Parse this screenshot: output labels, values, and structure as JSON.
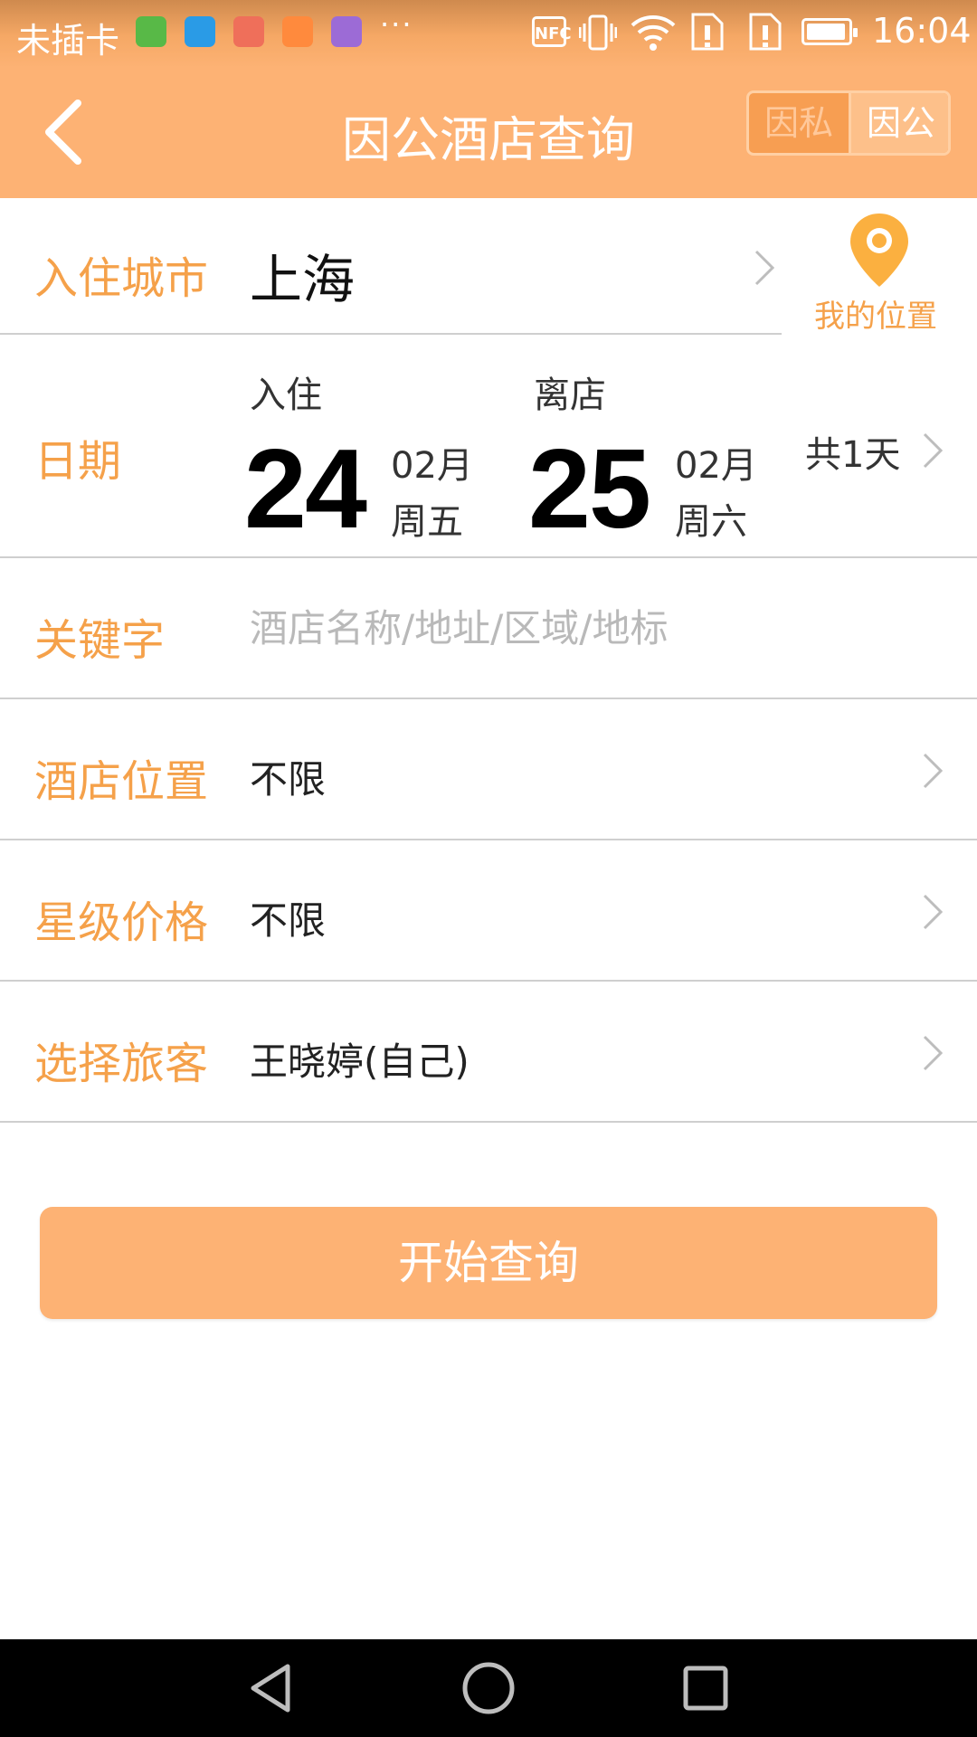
{
  "status_bar": {
    "carrier": "未插卡",
    "overflow": "···",
    "nfc": "NFC",
    "time": "16:04",
    "app_icons": [
      {
        "name": "app-icon-green",
        "color": "#4caf50"
      },
      {
        "name": "app-icon-blue",
        "color": "#2196f3"
      },
      {
        "name": "app-icon-multicolor",
        "color": "#e57373"
      },
      {
        "name": "app-icon-orange",
        "color": "#ff8a3d"
      },
      {
        "name": "app-icon-purple",
        "color": "#9c6bd6"
      }
    ],
    "system_icons": [
      "vibrate-icon",
      "wifi-icon",
      "sim-alert-icon",
      "sim-alert-icon",
      "battery-icon"
    ]
  },
  "header": {
    "back_icon": "chevron-left-icon",
    "title": "因公酒店查询",
    "toggle": {
      "private": "因私",
      "business": "因公",
      "selected": "因公"
    }
  },
  "form": {
    "city": {
      "label": "入住城市",
      "value": "上海",
      "location_icon": "map-pin-icon",
      "location_label": "我的位置"
    },
    "date": {
      "label": "日期",
      "check_in": {
        "caption": "入住",
        "day": "24",
        "month": "02月",
        "weekday": "周五"
      },
      "check_out": {
        "caption": "离店",
        "day": "25",
        "month": "02月",
        "weekday": "周六"
      },
      "nights": "共1天"
    },
    "keyword": {
      "label": "关键字",
      "value": "",
      "placeholder": "酒店名称/地址/区域/地标"
    },
    "location": {
      "label": "酒店位置",
      "value": "不限"
    },
    "star_price": {
      "label": "星级价格",
      "value": "不限"
    },
    "traveler": {
      "label": "选择旅客",
      "value": "王晓婷(自己)"
    }
  },
  "search_button": "开始查询",
  "nav_bar": [
    "back-triangle-icon",
    "home-circle-icon",
    "recents-square-icon"
  ],
  "colors": {
    "accent": "#fdb274",
    "label": "#f5a14a",
    "divider": "#cfcfcf"
  }
}
